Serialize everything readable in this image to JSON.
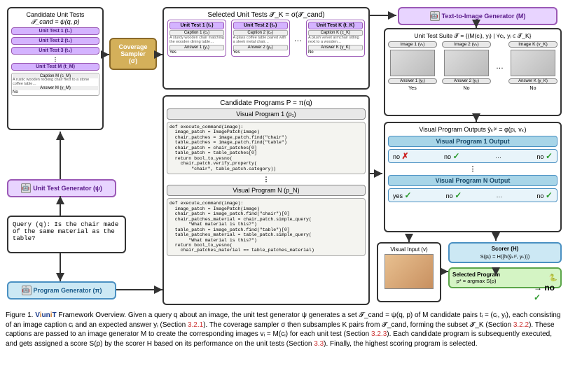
{
  "candidate_tests": {
    "header": "Candidate Unit Tests",
    "formula": "𝓣_cand = ψ(q, p)",
    "items": [
      {
        "label": "Unit Test 1 (t₁)"
      },
      {
        "label": "Unit Test 2 (t₂)"
      },
      {
        "label": "Unit Test 3 (t₃)"
      },
      {
        "label": "Unit Test M (t_M)"
      }
    ],
    "caption_label": "Caption M (c_M)",
    "caption_text": "A rustic wooden rocking chair next to a stone coffee table…",
    "answer_label": "Answer M (y_M)",
    "answer_val": "No"
  },
  "coverage": {
    "label": "Coverage Sampler",
    "sigma": "(σ)"
  },
  "selected_tests": {
    "header": "Selected Unit Tests 𝓣_K = σ(𝓣_cand)",
    "items": [
      {
        "hdr": "Unit Test 1 (t₁)",
        "cap": "Caption 1 (c₁)",
        "txt": "A sturdy wooden chair matching the wooden dining table…",
        "ans": "Answer 1 (y₁)",
        "val": "Yes"
      },
      {
        "hdr": "Unit Test 2 (t₂)",
        "cap": "Caption 2 (c₂)",
        "txt": "A glass coffee table paired with a sleek metal chair…",
        "ans": "Answer 2 (y₂)",
        "val": "Yes"
      },
      {
        "hdr": "Unit Test K (t_K)",
        "cap": "Caption K (c_K)",
        "txt": "A plush velvet armchair sitting next to a wooden…",
        "ans": "Answer K (y_K)",
        "val": "No"
      }
    ]
  },
  "t2i": {
    "label": "Text-to-Image Generator (M)"
  },
  "suite": {
    "header": "Unit Test Suite 𝓣 = {(M(cᵢ), yᵢ) | ∀cᵢ, yᵢ ∈ 𝓣_K}",
    "imgs": [
      {
        "hdr": "Image 1 (v₁)",
        "ans": "Answer 1 (y₁)",
        "val": "Yes"
      },
      {
        "hdr": "Image 2 (v₂)",
        "ans": "Answer 2 (y₂)",
        "val": "No"
      },
      {
        "hdr": "Image K (v_K)",
        "ans": "Answer K (y_K)",
        "val": "No"
      }
    ],
    "ellipsis": "…"
  },
  "programs": {
    "header": "Candidate Programs P = π(q)",
    "p1": {
      "label": "Visual Program 1 (p₁)",
      "code": "def execute_command(image):\n  image_patch = ImagePatch(image)\n  chair_patches = image_patch.find(\"chair\")\n  table_patches = image_patch.find(\"table\")\n  chair_patch = chair_patches[0]\n  table_patch = table_patches[0]\n  return bool_to_yesno(\n    chair_patch.verify_property(\n        \"chair\", table_patch.category))"
    },
    "pn": {
      "label": "Visual Program N (p_N)",
      "code": "def execute_command(image):\n  image_patch = ImagePatch(image)\n  chair_patch = image_patch.find(\"chair\")[0]\n  chair_patches_material = chair_patch.simple_query(\n       \"What material is this?\")\n  table_patch = image_patch.find(\"table\")[0]\n  table_patches_material = table_patch.simple_query(\n       \"What material is this?\")\n  return bool_to_yesno(\n    chair_patches_material == table_patches_material)"
    }
  },
  "outputs": {
    "header": "Visual Program Outputs ŷₖᵖⁱ = φ(pᵢ, vₖ)",
    "p1": {
      "label": "Visual Program 1 Output",
      "vals": [
        "no",
        "no",
        "no"
      ],
      "marks": [
        "x",
        "c",
        "c"
      ]
    },
    "pn": {
      "label": "Visual Program N Output",
      "vals": [
        "yes",
        "no",
        "no"
      ],
      "marks": [
        "c",
        "c",
        "c"
      ]
    },
    "ellipsis": "…"
  },
  "visual_input": {
    "label": "Visual Input (v)"
  },
  "scorer": {
    "label": "Scorer (H)",
    "formula": "S(pᵢ) = H({h(ŷₖᵖⁱ, yₖ)})"
  },
  "selected": {
    "label": "Selected Program",
    "formula": "p* = argmax S(p)",
    "result": "no"
  },
  "utg": {
    "label": "Unit Test Generator (ψ)"
  },
  "pg": {
    "label": "Program Generator (π)"
  },
  "query": {
    "text": "Query (q): Is the chair made of the same material as the table?"
  },
  "caption": {
    "prefix": "Figure 1. ",
    "brand": "ViUniT",
    "body1": " Framework Overview. Given a query q about an image, the unit test generator ψ generates a set 𝓣_cand = ψ(q, p) of M candidate pairs tᵢ = (cᵢ, yᵢ), each consisting of an image caption cᵢ and an expected answer yᵢ (Section ",
    "ref1": "3.2.1",
    "body2": "). The coverage sampler σ then subsamples K pairs from 𝓣_cand, forming the subset 𝓣_K (Section ",
    "ref2": "3.2.2",
    "body3": "). These captions are passed to an image generator M to create the corresponding images vᵢ = M(cᵢ) for each unit test (Section ",
    "ref3": "3.2.3",
    "body4": "). Each candidate program is subsequently executed, and gets assigned a score S(p) by the scorer H based on its performance on the unit tests (Section ",
    "ref4": "3.3",
    "body5": "). Finally, the highest scoring program is selected."
  }
}
